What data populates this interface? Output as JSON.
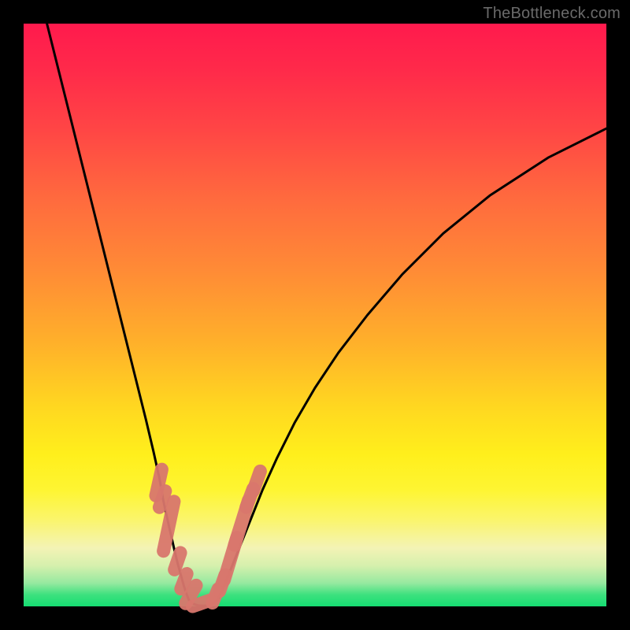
{
  "watermark": "TheBottleneck.com",
  "colors": {
    "frame": "#000000",
    "curve": "#000000",
    "marker_fill": "#d9776d",
    "marker_stroke": "#b85a52",
    "gradient_stops": [
      "#ff1a4d",
      "#ff2a4a",
      "#ff4545",
      "#ff6a3e",
      "#ff8a36",
      "#ffb12a",
      "#ffd820",
      "#ffef1c",
      "#fef532",
      "#fbf56a",
      "#f3f3b5",
      "#d6f0ad",
      "#96e9a0",
      "#3de17e",
      "#15dd72"
    ]
  },
  "chart_data": {
    "type": "line",
    "title": "",
    "xlabel": "",
    "ylabel": "",
    "xlim": [
      0,
      100
    ],
    "ylim": [
      0,
      100
    ],
    "grid": false,
    "legend": false,
    "series": [
      {
        "name": "left-branch",
        "x": [
          4,
          6,
          8,
          10,
          12,
          14,
          16,
          18,
          19.5,
          21,
          22.3,
          23.3,
          24,
          25,
          25.8,
          26.4,
          27,
          27.5,
          28,
          28.4
        ],
        "values": [
          100,
          92,
          84,
          76,
          68,
          60,
          52,
          44,
          38,
          32,
          26.5,
          22,
          18,
          13.5,
          10,
          7.5,
          5.3,
          3.5,
          2,
          1
        ]
      },
      {
        "name": "valley-floor",
        "x": [
          28.4,
          29.2,
          30.0,
          30.8,
          31.6,
          32.4,
          33.2
        ],
        "values": [
          1,
          0.4,
          0.15,
          0.1,
          0.15,
          0.4,
          1
        ]
      },
      {
        "name": "right-branch",
        "x": [
          33.2,
          34,
          35,
          36.2,
          37.6,
          39.2,
          41,
          43.5,
          46.5,
          50,
          54,
          59,
          65,
          72,
          80,
          90,
          100
        ],
        "values": [
          1,
          2.6,
          5,
          8,
          11.5,
          15.5,
          20,
          25.5,
          31.5,
          37.5,
          43.5,
          50,
          57,
          64,
          70.5,
          77,
          82
        ]
      }
    ],
    "markers": [
      {
        "type": "round",
        "x_range": [
          22.7,
          23.7
        ],
        "y_range": [
          19,
          23.5
        ]
      },
      {
        "type": "round",
        "x_range": [
          23.3,
          24.3
        ],
        "y_range": [
          17,
          19.8
        ]
      },
      {
        "type": "long",
        "x_range": [
          24.0,
          25.8
        ],
        "y_range": [
          9.5,
          18
        ]
      },
      {
        "type": "round",
        "x_range": [
          25.9,
          26.9
        ],
        "y_range": [
          6.3,
          9.2
        ]
      },
      {
        "type": "round",
        "x_range": [
          27.0,
          28.0
        ],
        "y_range": [
          3.0,
          5.6
        ]
      },
      {
        "type": "long",
        "x_range": [
          27.8,
          29.6
        ],
        "y_range": [
          0.5,
          3.6
        ]
      },
      {
        "type": "long",
        "x_range": [
          29.0,
          32.4
        ],
        "y_range": [
          0.0,
          1.2
        ]
      },
      {
        "type": "round",
        "x_range": [
          32.4,
          33.4
        ],
        "y_range": [
          0.6,
          3.0
        ]
      },
      {
        "type": "round",
        "x_range": [
          33.6,
          34.6
        ],
        "y_range": [
          2.6,
          5.4
        ]
      },
      {
        "type": "long",
        "x_range": [
          34.4,
          36.6
        ],
        "y_range": [
          4.5,
          11.8
        ]
      },
      {
        "type": "long",
        "x_range": [
          36.2,
          38.6
        ],
        "y_range": [
          10.5,
          18.2
        ]
      },
      {
        "type": "round",
        "x_range": [
          38.2,
          39.4
        ],
        "y_range": [
          17.0,
          20.2
        ]
      },
      {
        "type": "round",
        "x_range": [
          39.4,
          40.6
        ],
        "y_range": [
          19.8,
          23.2
        ]
      }
    ]
  }
}
